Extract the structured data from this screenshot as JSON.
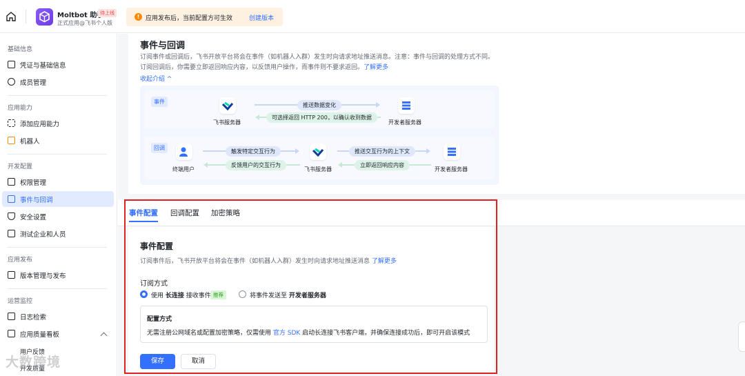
{
  "topbar": {
    "app_name": "Moltbot 助手",
    "app_badge": "待上线",
    "app_sub": "正式应用@飞书个人版",
    "notice_text": "应用发布后，当前配置方可生效",
    "notice_link": "创建版本"
  },
  "sidebar": {
    "sections": [
      {
        "title": "基础信息",
        "items": [
          "凭证与基础信息",
          "成员管理"
        ]
      },
      {
        "title": "应用能力",
        "items": [
          "添加应用能力",
          "机器人"
        ]
      },
      {
        "title": "开发配置",
        "items": [
          "权限管理",
          "事件与回调",
          "安全设置",
          "测试企业和人员"
        ]
      },
      {
        "title": "应用发布",
        "items": [
          "版本管理与发布"
        ]
      },
      {
        "title": "运营监控",
        "items": [
          "日志检索",
          "应用质量看板"
        ]
      }
    ],
    "sub_items": [
      "用户反馈",
      "开发质量"
    ],
    "active_item": "事件与回调"
  },
  "intro": {
    "title": "事件与回调",
    "desc_1": "订阅事件或回调后，飞书开放平台将会在事件（如机器人入群）发生时向请求地址推送消息。注意：事件与回调的处理方式不同。订阅回调后，你需要立即返回响应内容，以反馈用户操作，而事件则不要求返回。",
    "learn_more": "了解更多",
    "collapse": "收起介绍"
  },
  "diagram": {
    "event_tag": "事件",
    "callback_tag": "回调",
    "feishu_server": "飞书服务器",
    "dev_server": "开发者服务器",
    "end_user": "终端用户",
    "event_push": "推送数据变化",
    "event_reply": "可选择返回 HTTP 200，以确认收到数据",
    "cb_trigger": "触发特定交互行为",
    "cb_feedback": "反馈用户的交互行为",
    "cb_push_ctx": "推送交互行为的上下文",
    "cb_reply": "立即返回响应内容"
  },
  "tabs": [
    "事件配置",
    "回调配置",
    "加密策略"
  ],
  "config": {
    "title": "事件配置",
    "desc": "订阅事件后，飞书开放平台将会在事件（如机器人入群）发生时向请求地址推送消息",
    "desc_link": "了解更多",
    "sub_label": "订阅方式",
    "opt1_pre": "使用",
    "opt1_bold": "长连接",
    "opt1_post": "接收事件",
    "opt1_badge": "推荐",
    "opt2_pre": "将事件发送至",
    "opt2_bold": "开发者服务器",
    "mode_title": "配置方式",
    "mode_desc_pre": "无需注册公网域名或配置加密策略，仅需使用",
    "mode_desc_link": "官方 SDK",
    "mode_desc_post": "启动长连接飞书客户端，并确保连接成功后，即可开启该模式",
    "save": "保存",
    "cancel": "取消"
  },
  "watermark": "大数跨境"
}
